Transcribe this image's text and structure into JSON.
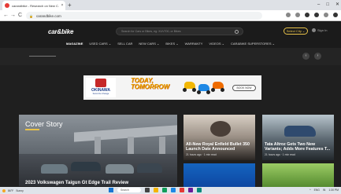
{
  "browser": {
    "tab_title": "carandbike - Research on New C...",
    "tab_close": "×",
    "new_tab": "+",
    "window_controls": [
      "–",
      "□",
      "✕"
    ],
    "nav": {
      "back": "←",
      "forward": "→",
      "reload": "C"
    },
    "url": "carandbike.com"
  },
  "site": {
    "logo": "car&bike",
    "search_placeholder": "Search for Cars or Bikes, eg: XUV700, or Bikes",
    "city_button": "Select City ⌄",
    "signin": "Sign In",
    "nav": [
      "MAGAZINE",
      "USED CARS ⌄",
      "SELL CAR",
      "NEW CARS ⌄",
      "BIKES ⌄",
      "WARRANTY",
      "VIDEOS ⌄",
      "CAR&BIKE SUPERSTORES ⌄"
    ],
    "active_nav": "MAGAZINE"
  },
  "ad": {
    "brand": "OKINAWA",
    "tagline": "Scoot the Change",
    "headline_1": "TODAY,",
    "headline_2": "TOMORROW",
    "cta": "BOOK NOW",
    "colors": {
      "yellow": "#f2b705",
      "blue": "#1e88e5",
      "orange": "#ef6c00"
    }
  },
  "cover": {
    "label": "Cover Story",
    "caption": "2023 Volkswagen Taigun Gt Edge Trail Review"
  },
  "news": [
    {
      "title": "All-New Royal Enfield Bullet 350 Launch Date Announced",
      "meta": "21 hours ago · 1 min read"
    },
    {
      "title": "Tata Altroz Gets Two New Variants; Adds More Features T...",
      "meta": "21 hours ago · 1 min read"
    }
  ],
  "taskbar": {
    "weather": "86°F",
    "weather_note": "Sunny",
    "search": "Search",
    "tray": [
      "^",
      "ENG",
      "IN",
      "1:30 PM"
    ]
  },
  "colors": {
    "accent": "#e8c24a",
    "bg": "#1f1f1f"
  }
}
